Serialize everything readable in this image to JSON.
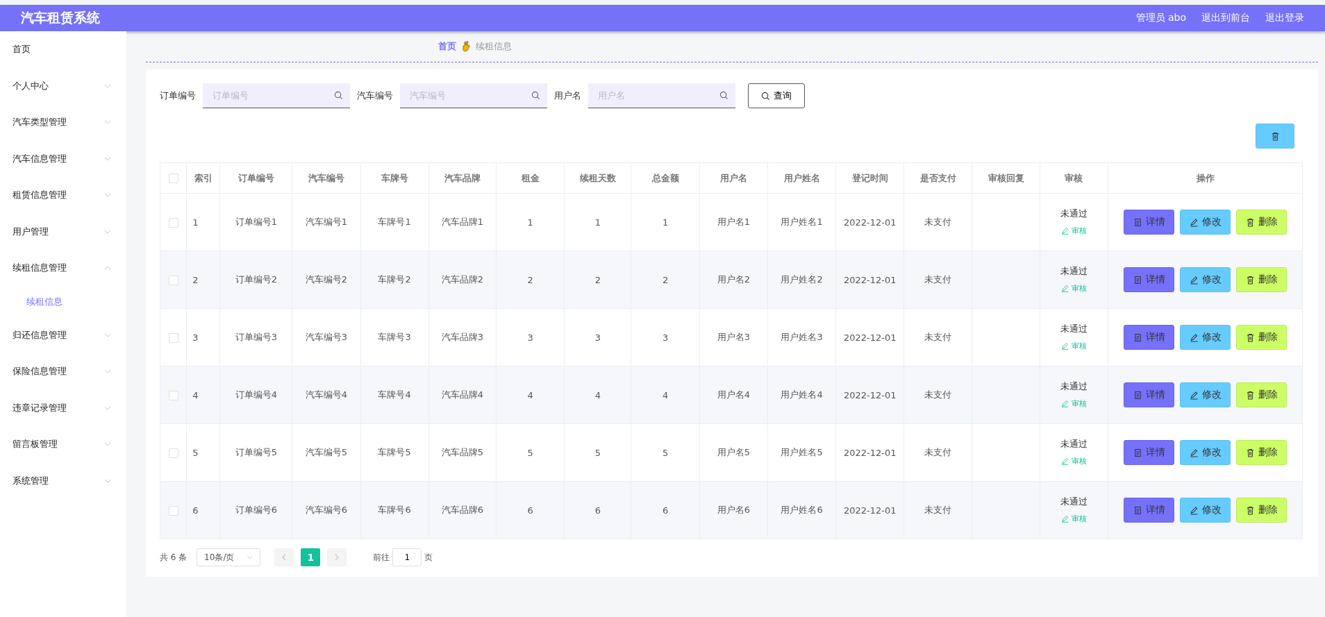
{
  "header": {
    "title": "汽车租赁系统",
    "user": "管理员 abo",
    "links": [
      "退出到前台",
      "退出登录"
    ]
  },
  "sidebar": {
    "items": [
      {
        "label": "首页"
      },
      {
        "label": "个人中心",
        "expanded": false
      },
      {
        "label": "汽车类型管理",
        "expanded": false
      },
      {
        "label": "汽车信息管理",
        "expanded": false
      },
      {
        "label": "租赁信息管理",
        "expanded": false
      },
      {
        "label": "用户管理",
        "expanded": false
      },
      {
        "label": "续租信息管理",
        "expanded": true,
        "children": [
          {
            "label": "续租信息",
            "selected": true
          }
        ]
      },
      {
        "label": "归还信息管理",
        "expanded": false
      },
      {
        "label": "保险信息管理",
        "expanded": false
      },
      {
        "label": "违章记录管理",
        "expanded": false
      },
      {
        "label": "留言板管理",
        "expanded": false
      },
      {
        "label": "系统管理",
        "expanded": false
      }
    ]
  },
  "breadcrumb": [
    "首页",
    "续租信息"
  ],
  "search": {
    "fields": [
      {
        "label": "订单编号",
        "placeholder": "订单编号"
      },
      {
        "label": "汽车编号",
        "placeholder": "汽车编号"
      },
      {
        "label": "用户名",
        "placeholder": "用户名"
      }
    ],
    "button": "查询"
  },
  "table": {
    "all_checked": false,
    "columns": [
      "索引",
      "订单编号",
      "汽车编号",
      "车牌号",
      "汽车品牌",
      "租金",
      "续租天数",
      "总金额",
      "用户名",
      "用户姓名",
      "登记时间",
      "是否支付",
      "审核回复",
      "审核",
      "操作"
    ],
    "rows": [
      {
        "checked": false,
        "cells": [
          "1",
          "订单编号1",
          "汽车编号1",
          "车牌号1",
          "汽车品牌1",
          "1",
          "1",
          "1",
          "用户名1",
          "用户姓名1",
          "2022-12-01",
          "未支付",
          ""
        ],
        "status": "未通过",
        "review": "审核",
        "actions": [
          {
            "kind": "detail",
            "label": "详情"
          },
          {
            "kind": "edit",
            "label": "修改"
          },
          {
            "kind": "delete",
            "label": "删除"
          }
        ]
      },
      {
        "checked": false,
        "cells": [
          "2",
          "订单编号2",
          "汽车编号2",
          "车牌号2",
          "汽车品牌2",
          "2",
          "2",
          "2",
          "用户名2",
          "用户姓名2",
          "2022-12-01",
          "未支付",
          ""
        ],
        "status": "未通过",
        "review": "审核",
        "actions": [
          {
            "kind": "detail",
            "label": "详情"
          },
          {
            "kind": "edit",
            "label": "修改"
          },
          {
            "kind": "delete",
            "label": "删除"
          }
        ]
      },
      {
        "checked": false,
        "cells": [
          "3",
          "订单编号3",
          "汽车编号3",
          "车牌号3",
          "汽车品牌3",
          "3",
          "3",
          "3",
          "用户名3",
          "用户姓名3",
          "2022-12-01",
          "未支付",
          ""
        ],
        "status": "未通过",
        "review": "审核",
        "actions": [
          {
            "kind": "detail",
            "label": "详情"
          },
          {
            "kind": "edit",
            "label": "修改"
          },
          {
            "kind": "delete",
            "label": "删除"
          }
        ]
      },
      {
        "checked": false,
        "cells": [
          "4",
          "订单编号4",
          "汽车编号4",
          "车牌号4",
          "汽车品牌4",
          "4",
          "4",
          "4",
          "用户名4",
          "用户姓名4",
          "2022-12-01",
          "未支付",
          ""
        ],
        "status": "未通过",
        "review": "审核",
        "actions": [
          {
            "kind": "detail",
            "label": "详情"
          },
          {
            "kind": "edit",
            "label": "修改"
          },
          {
            "kind": "delete",
            "label": "删除"
          }
        ]
      },
      {
        "checked": false,
        "cells": [
          "5",
          "订单编号5",
          "汽车编号5",
          "车牌号5",
          "汽车品牌5",
          "5",
          "5",
          "5",
          "用户名5",
          "用户姓名5",
          "2022-12-01",
          "未支付",
          ""
        ],
        "status": "未通过",
        "review": "审核",
        "actions": [
          {
            "kind": "detail",
            "label": "详情"
          },
          {
            "kind": "edit",
            "label": "修改"
          },
          {
            "kind": "delete",
            "label": "删除"
          }
        ]
      },
      {
        "checked": false,
        "cells": [
          "6",
          "订单编号6",
          "汽车编号6",
          "车牌号6",
          "汽车品牌6",
          "6",
          "6",
          "6",
          "用户名6",
          "用户姓名6",
          "2022-12-01",
          "未支付",
          ""
        ],
        "status": "未通过",
        "review": "审核",
        "actions": [
          {
            "kind": "detail",
            "label": "详情"
          },
          {
            "kind": "edit",
            "label": "修改"
          },
          {
            "kind": "delete",
            "label": "删除"
          }
        ]
      }
    ]
  },
  "pagination": {
    "total": "共 6 条",
    "page_size": "10条/页",
    "pages": [
      {
        "label": "1",
        "selected": true
      }
    ],
    "goto_label": "前往",
    "goto_value": "1",
    "goto_suffix": "页"
  }
}
